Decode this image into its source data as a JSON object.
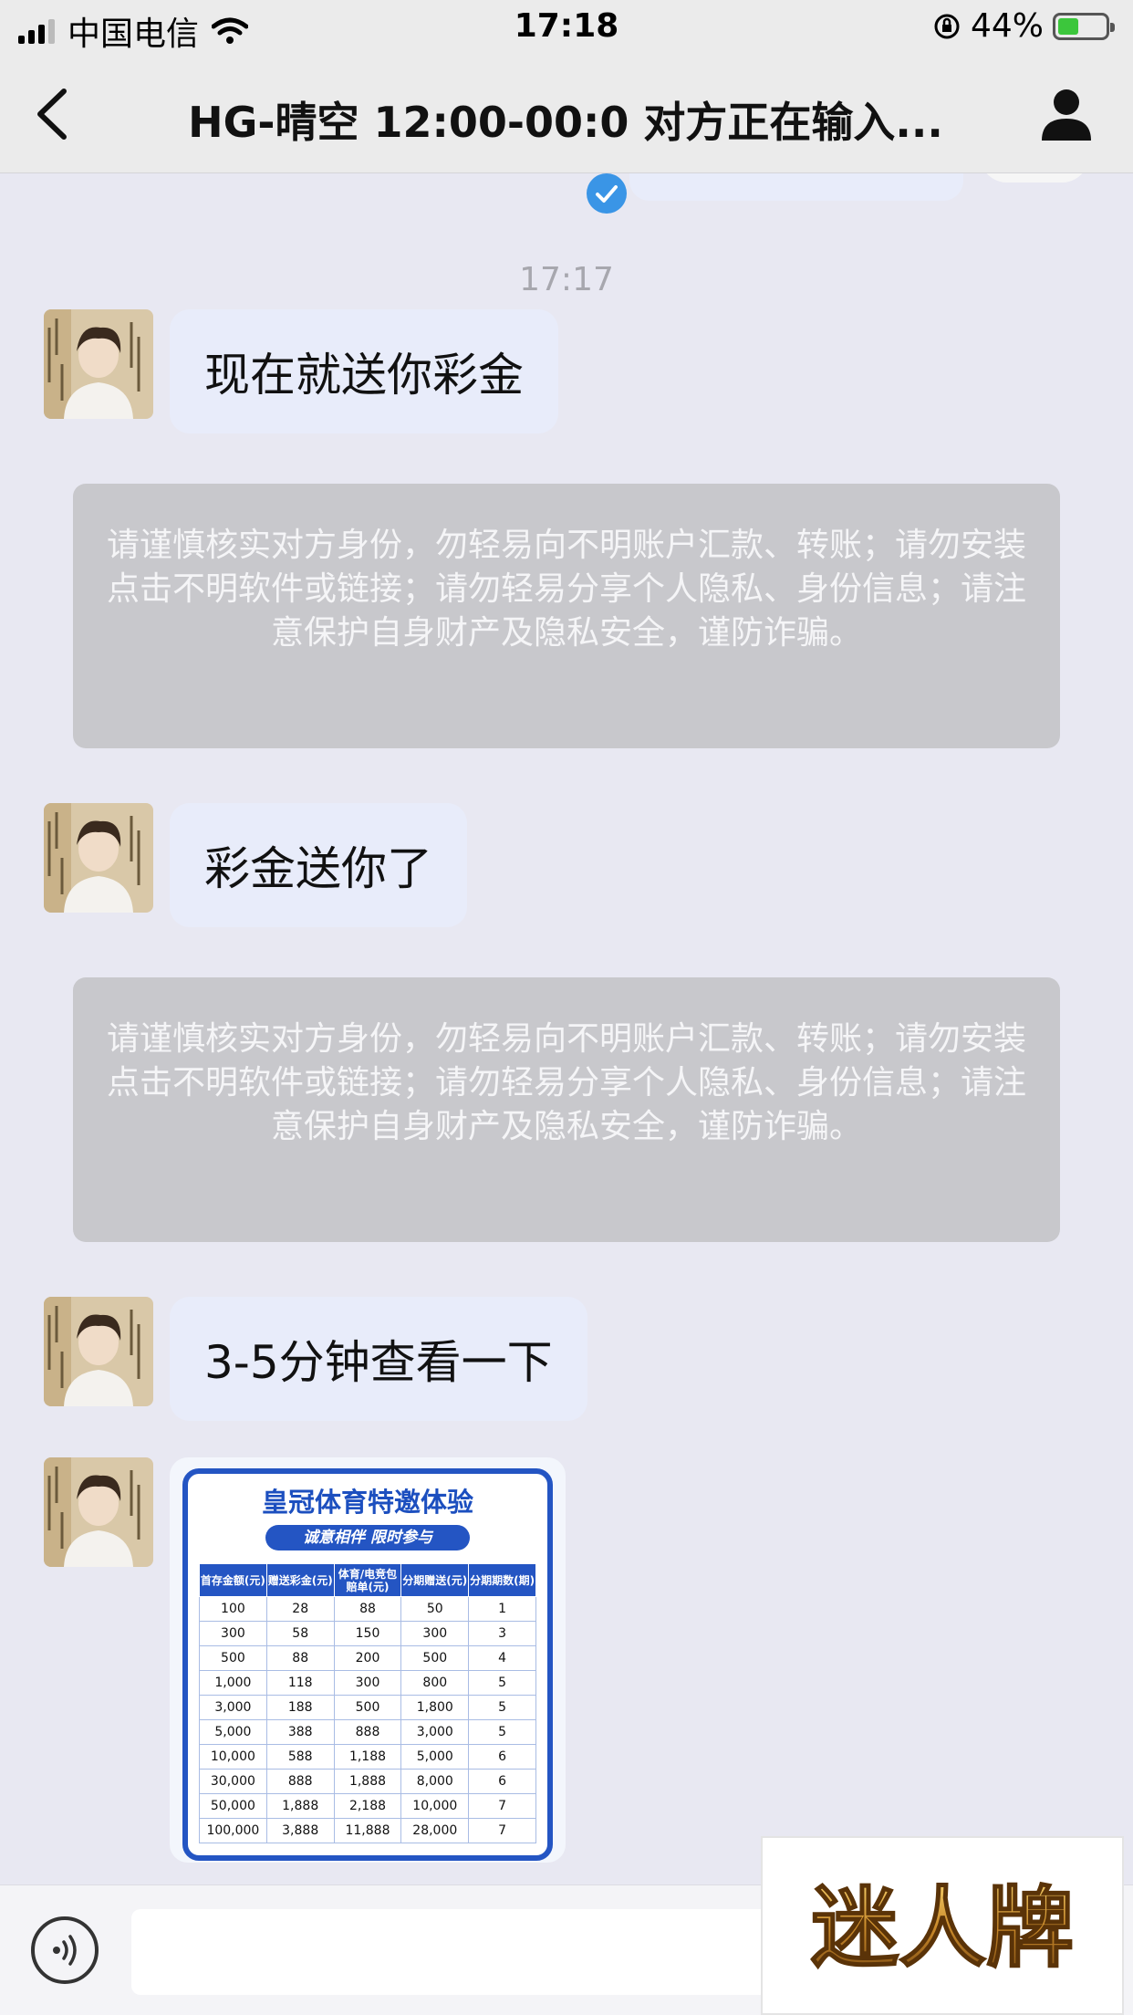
{
  "status_bar": {
    "carrier": "中国电信",
    "time": "17:18",
    "battery": "44%",
    "battery_level": 0.44
  },
  "nav": {
    "title": "HG-晴空 12:00-00:0 对方正在输入..."
  },
  "chat": {
    "timestamp": "17:17",
    "messages": [
      {
        "text": "现在就送你彩金"
      },
      {
        "text": "彩金送你了"
      },
      {
        "text": "3-5分钟查看一下"
      }
    ],
    "warning": "请谨慎核实对方身份，勿轻易向不明账户汇款、转账；请勿安装点击不明软件或链接；请勿轻易分享个人隐私、身份信息；请注意保护自身财产及隐私安全，谨防诈骗。"
  },
  "promo_image": {
    "title": "皇冠体育特邀体验",
    "subtitle": "诚意相伴  限时参与",
    "headers": [
      "首存金额(元)",
      "赠送彩金(元)",
      "体育/电竞包赔单(元)",
      "分期赠送(元)",
      "分期期数(期)"
    ],
    "rows": [
      [
        "100",
        "28",
        "88",
        "50",
        "1"
      ],
      [
        "300",
        "58",
        "150",
        "300",
        "3"
      ],
      [
        "500",
        "88",
        "200",
        "500",
        "4"
      ],
      [
        "1,000",
        "118",
        "300",
        "800",
        "5"
      ],
      [
        "3,000",
        "188",
        "500",
        "1,800",
        "5"
      ],
      [
        "5,000",
        "388",
        "888",
        "3,000",
        "5"
      ],
      [
        "10,000",
        "588",
        "1,188",
        "5,000",
        "6"
      ],
      [
        "30,000",
        "888",
        "1,888",
        "8,000",
        "6"
      ],
      [
        "50,000",
        "1,888",
        "2,188",
        "10,000",
        "7"
      ],
      [
        "100,000",
        "3,888",
        "11,888",
        "28,000",
        "7"
      ]
    ]
  },
  "input_bar": {
    "placeholder": ""
  },
  "watermark": {
    "text": "迷人牌"
  },
  "colors": {
    "accent": "#3a95e6",
    "promo_blue": "#2455c3",
    "bubble": "#e8ecfa",
    "warning_bg": "#c8c8cc"
  },
  "icons": [
    "signal-icon",
    "wifi-icon",
    "rotation-lock-icon",
    "battery-icon",
    "back-chevron-icon",
    "profile-icon",
    "check-icon",
    "voice-icon"
  ]
}
